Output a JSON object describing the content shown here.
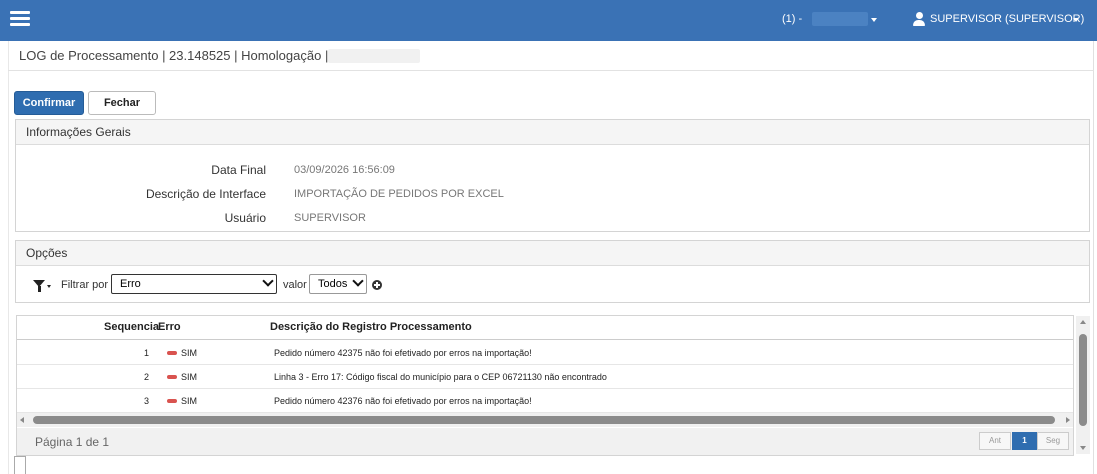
{
  "header": {
    "env_label": "(1) -",
    "user_label": "SUPERVISOR (SUPERVISOR)"
  },
  "page": {
    "title": "LOG de Processamento | 23.148525 | Homologação |"
  },
  "toolbar": {
    "confirm_label": "Confirmar",
    "close_label": "Fechar"
  },
  "info_panel": {
    "title": "Informações Gerais",
    "fields": [
      {
        "label": "Data Final",
        "value": "03/09/2026 16:56:09"
      },
      {
        "label": "Descrição de Interface",
        "value": "IMPORTAÇÃO DE PEDIDOS POR EXCEL"
      },
      {
        "label": "Usuário",
        "value": "SUPERVISOR"
      }
    ]
  },
  "options_panel": {
    "title": "Opções",
    "filter_label": "Filtrar por",
    "filter_value": "Erro",
    "valor_label": "valor",
    "valor_value": "Todos"
  },
  "grid": {
    "columns": [
      "Sequencia",
      "Erro",
      "Descrição do Registro Processamento"
    ],
    "rows": [
      {
        "seq": "1",
        "erro": "SIM",
        "desc": "Pedido número 42375 não foi efetivado por erros na importação!"
      },
      {
        "seq": "2",
        "erro": "SIM",
        "desc": "Linha 3 - Erro 17: Código fiscal do município para o CEP 06721130 não encontrado"
      },
      {
        "seq": "3",
        "erro": "SIM",
        "desc": "Pedido número 42376 não foi efetivado por erros na importação!"
      }
    ],
    "pager_text": "Página 1 de 1",
    "prev_label": "Ant",
    "page_label": "1",
    "next_label": "Seg"
  },
  "colors": {
    "topbar": "#3a72b5",
    "primary": "#2f6db0",
    "error_dot": "#d9534f"
  }
}
